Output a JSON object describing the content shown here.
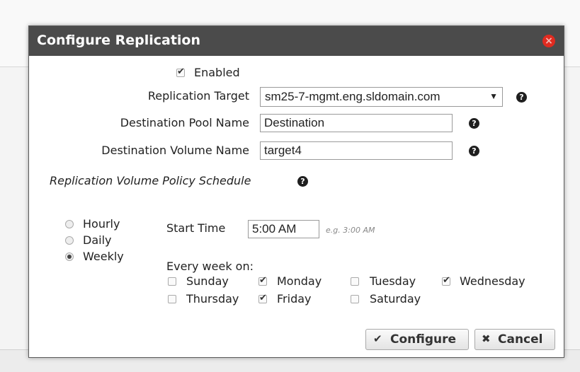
{
  "dialog": {
    "title": "Configure Replication",
    "close_icon": "×"
  },
  "enabled": {
    "label": "Enabled",
    "checked": true
  },
  "replication_target": {
    "label": "Replication Target",
    "value": "sm25-7-mgmt.eng.sldomain.com",
    "arrow": "▼"
  },
  "destination_pool": {
    "label": "Destination Pool Name",
    "value": "Destination"
  },
  "destination_volume": {
    "label": "Destination Volume Name",
    "value": "target4"
  },
  "help_glyph": "?",
  "schedule": {
    "heading": "Replication Volume Policy Schedule",
    "frequency": [
      {
        "label": "Hourly",
        "selected": false
      },
      {
        "label": "Daily",
        "selected": false
      },
      {
        "label": "Weekly",
        "selected": true
      }
    ],
    "start_time": {
      "label": "Start Time",
      "value": "5:00 AM",
      "hint": "e.g. 3:00 AM"
    },
    "every_week_label": "Every week on:",
    "days": [
      {
        "label": "Sunday",
        "checked": false
      },
      {
        "label": "Monday",
        "checked": true
      },
      {
        "label": "Tuesday",
        "checked": false
      },
      {
        "label": "Wednesday",
        "checked": true
      },
      {
        "label": "Thursday",
        "checked": false
      },
      {
        "label": "Friday",
        "checked": true
      },
      {
        "label": "Saturday",
        "checked": false
      }
    ]
  },
  "buttons": {
    "configure": {
      "label": "Configure",
      "icon": "✔"
    },
    "cancel": {
      "label": "Cancel",
      "icon": "✖"
    }
  },
  "colors": {
    "titlebar": "#4b4b4b",
    "close": "#e02b20"
  }
}
